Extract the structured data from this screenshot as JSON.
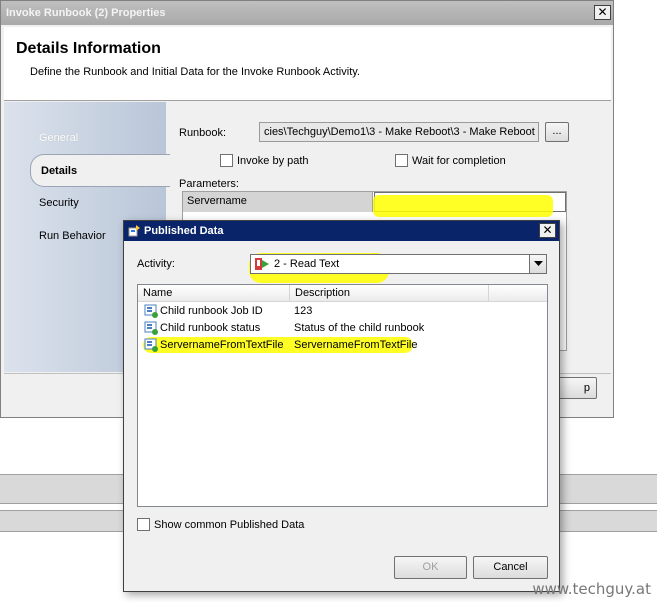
{
  "main_window": {
    "title": "Invoke Runbook (2) Properties",
    "close_glyph": "✕"
  },
  "header": {
    "title": "Details Information",
    "description": "Define the Runbook and Initial Data for the Invoke Runbook Activity."
  },
  "sidebar": {
    "items": [
      {
        "label": "General"
      },
      {
        "label": "Details"
      },
      {
        "label": "Security"
      },
      {
        "label": "Run Behavior"
      }
    ]
  },
  "details": {
    "runbook_label": "Runbook:",
    "runbook_value": "cies\\Techguy\\Demo1\\3 - Make Reboot\\3 - Make Reboot",
    "browse_label": "...",
    "invoke_by_path_label": "Invoke by path",
    "wait_for_completion_label": "Wait for completion",
    "parameters_label": "Parameters:",
    "parameters": [
      {
        "name": "Servername",
        "value": ""
      }
    ],
    "partial_button_label": "p"
  },
  "dialog": {
    "title": "Published Data",
    "close_glyph": "✕",
    "activity_label": "Activity:",
    "activity_value": "2 - Read Text",
    "columns": [
      "Name",
      "Description"
    ],
    "rows": [
      {
        "name": "Child runbook Job ID",
        "description": "123"
      },
      {
        "name": "Child runbook status",
        "description": "Status of the child runbook"
      },
      {
        "name": "ServernameFromTextFile",
        "description": "ServernameFromTextFile"
      }
    ],
    "show_common_label": "Show common Published Data",
    "ok_label": "OK",
    "cancel_label": "Cancel"
  },
  "watermark": "www.techguy.at",
  "colors": {
    "highlight": "#ffff00",
    "dialog_titlebar": "#0a246a",
    "main_titlebar": "#a9a9a9"
  }
}
